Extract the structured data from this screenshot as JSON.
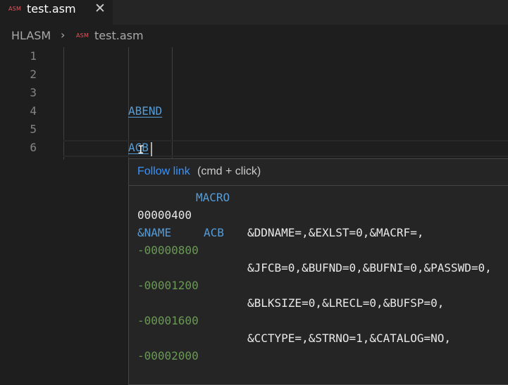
{
  "tab": {
    "badge": "ASM",
    "label": "test.asm"
  },
  "breadcrumb": {
    "folder": "HLASM",
    "badge": "ASM",
    "file": "test.asm"
  },
  "editor": {
    "line_numbers": [
      "1",
      "2",
      "3",
      "4",
      "5",
      "6"
    ],
    "lines": {
      "line4": "ABEND",
      "line6": "ACB"
    }
  },
  "hover": {
    "follow_link": "Follow link",
    "hint": "(cmd + click)",
    "macro": "MACRO",
    "seq1": "00000400",
    "name": "&NAME",
    "acb": "ACB",
    "p1": "&DDNAME=,&EXLST=0,&MACRF=,",
    "s1": "-00000800",
    "p2": "&JFCB=0,&BUFND=0,&BUFNI=0,&PASSWD=0,",
    "s2": "-00001200",
    "p3": "&BLKSIZE=0,&LRECL=0,&BUFSP=0,",
    "s3": "-00001600",
    "p4": "&CCTYPE=,&STRNO=1,&CATALOG=NO,",
    "s4": "-00002000"
  }
}
